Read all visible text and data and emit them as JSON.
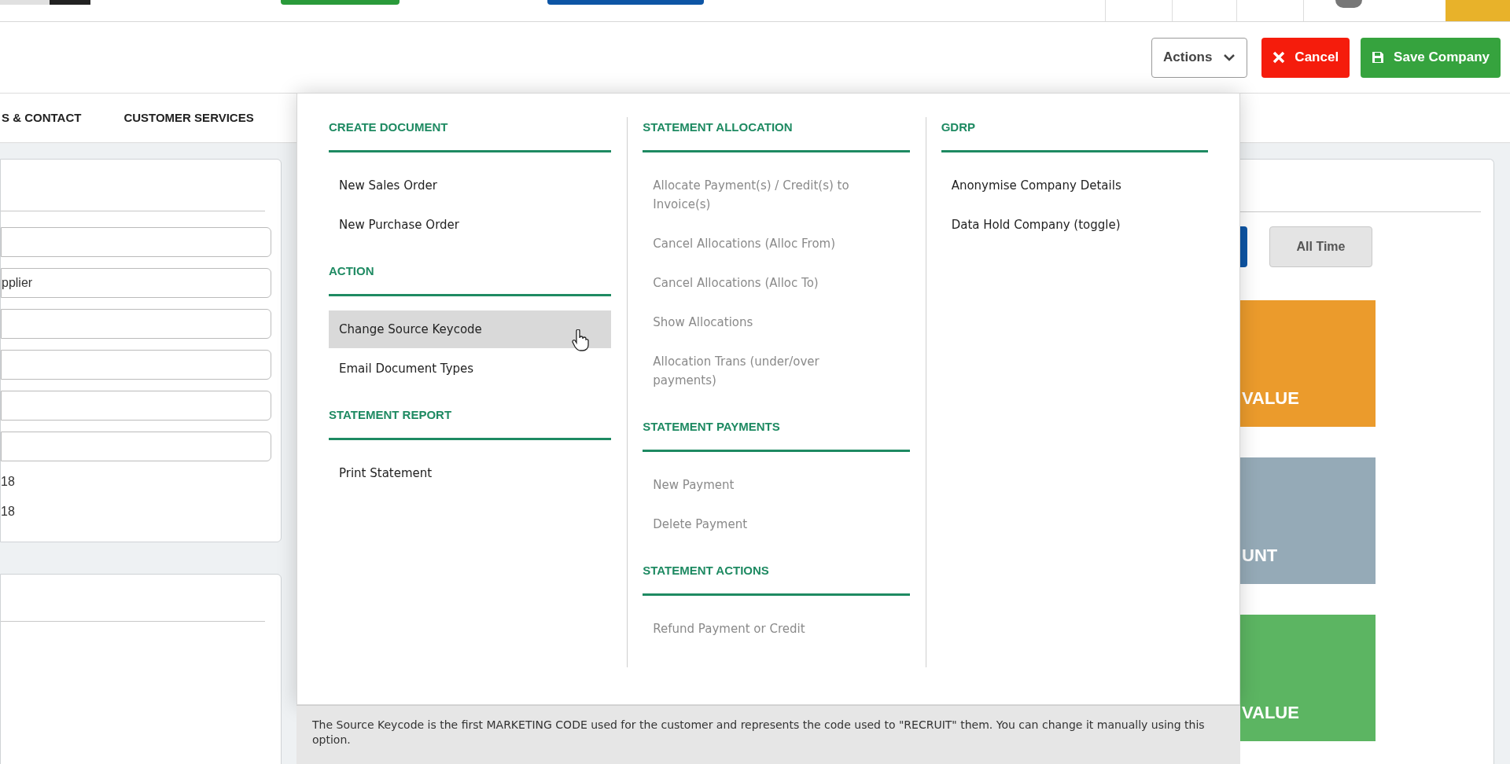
{
  "header": {
    "actions": {
      "label": "Actions"
    },
    "cancel": {
      "label": "Cancel"
    },
    "save": {
      "label": "Save Company"
    }
  },
  "tabs": [
    {
      "label": "S & CONTACT"
    },
    {
      "label": "CUSTOMER SERVICES"
    }
  ],
  "left_panel": {
    "fields": [
      {
        "kind": "field"
      },
      {
        "kind": "field",
        "value": "pplier"
      },
      {
        "kind": "field"
      },
      {
        "kind": "field"
      },
      {
        "kind": "field"
      },
      {
        "kind": "field"
      }
    ],
    "texts": [
      "18",
      "18"
    ]
  },
  "right_panel": {
    "all_time": {
      "label": "All Time"
    },
    "tiles": [
      {
        "label": "VALUE",
        "color": "#eb9b2c"
      },
      {
        "label": "UNT",
        "color": "#95aab7"
      },
      {
        "label": "VALUE",
        "color": "#5cb562"
      }
    ]
  },
  "menu": {
    "columns": [
      {
        "sections": [
          {
            "title": "CREATE DOCUMENT",
            "items": [
              {
                "label": "New Sales Order",
                "disabled": false,
                "hovered": false
              },
              {
                "label": "New Purchase Order",
                "disabled": false,
                "hovered": false
              }
            ]
          },
          {
            "title": "ACTION",
            "items": [
              {
                "label": "Change Source Keycode",
                "disabled": false,
                "hovered": true
              },
              {
                "label": "Email Document Types",
                "disabled": false,
                "hovered": false
              }
            ]
          },
          {
            "title": "STATEMENT REPORT",
            "items": [
              {
                "label": "Print Statement",
                "disabled": false,
                "hovered": false
              }
            ]
          }
        ]
      },
      {
        "sections": [
          {
            "title": "STATEMENT ALLOCATION",
            "items": [
              {
                "label": "Allocate Payment(s) / Credit(s) to Invoice(s)",
                "disabled": true,
                "hovered": false
              },
              {
                "label": "Cancel Allocations (Alloc From)",
                "disabled": true,
                "hovered": false
              },
              {
                "label": "Cancel Allocations (Alloc To)",
                "disabled": true,
                "hovered": false
              },
              {
                "label": "Show Allocations",
                "disabled": true,
                "hovered": false
              },
              {
                "label": "Allocation Trans (under/over payments)",
                "disabled": true,
                "hovered": false
              }
            ]
          },
          {
            "title": "STATEMENT PAYMENTS",
            "items": [
              {
                "label": "New Payment",
                "disabled": true,
                "hovered": false
              },
              {
                "label": "Delete Payment",
                "disabled": true,
                "hovered": false
              }
            ]
          },
          {
            "title": "STATEMENT ACTIONS",
            "items": [
              {
                "label": "Refund Payment or Credit",
                "disabled": true,
                "hovered": false
              }
            ]
          }
        ]
      },
      {
        "sections": [
          {
            "title": "GDRP",
            "items": [
              {
                "label": "Anonymise Company Details",
                "disabled": false,
                "hovered": false
              },
              {
                "label": "Data Hold Company (toggle)",
                "disabled": false,
                "hovered": false
              }
            ]
          }
        ]
      }
    ],
    "hint": "The Source Keycode is the first MARKETING CODE used for the customer and represents the code used to \"RECRUIT\" them. You can change it manually using this option."
  }
}
